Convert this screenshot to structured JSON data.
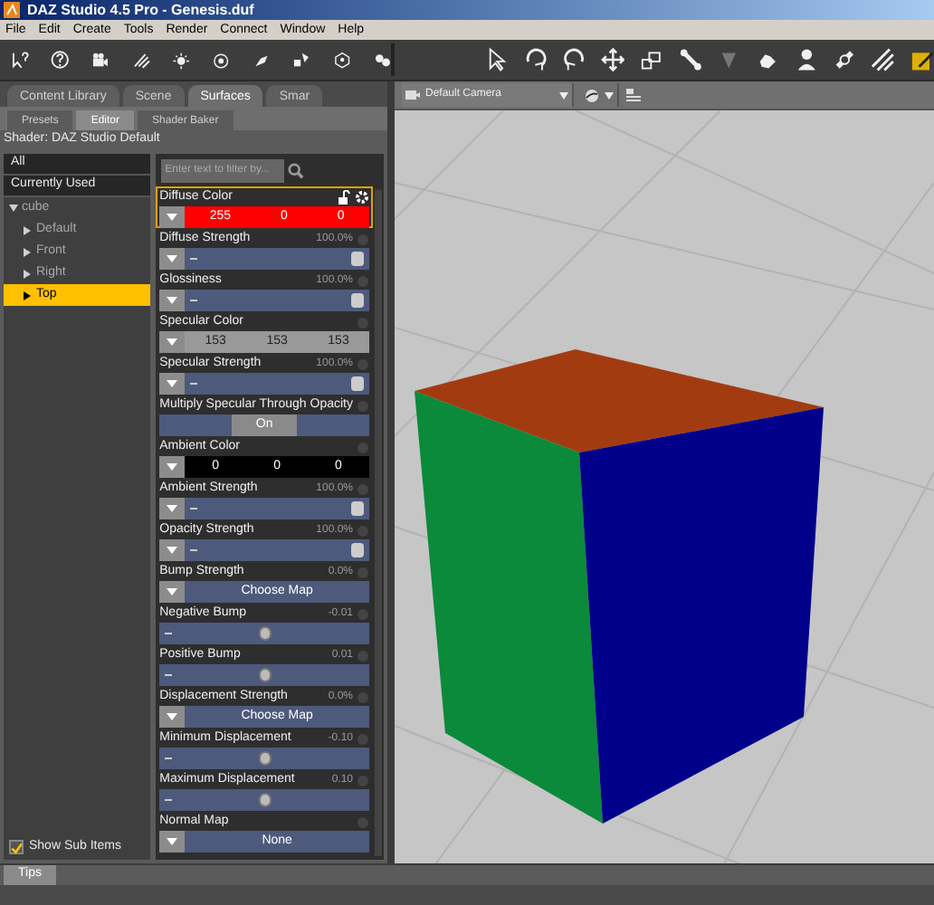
{
  "window": {
    "title": "DAZ Studio 4.5 Pro - Genesis.duf"
  },
  "menu": [
    "File",
    "Edit",
    "Create",
    "Tools",
    "Render",
    "Connect",
    "Window",
    "Help"
  ],
  "pane_tabs": [
    {
      "label": "Content Library",
      "selected": false
    },
    {
      "label": "Scene",
      "selected": false
    },
    {
      "label": "Surfaces",
      "selected": true
    },
    {
      "label": "Smar",
      "selected": false
    }
  ],
  "sub_tabs": [
    {
      "label": "Presets",
      "selected": false
    },
    {
      "label": "Editor",
      "selected": true
    },
    {
      "label": "Shader Baker",
      "selected": false
    }
  ],
  "shader_label": "Shader: DAZ Studio Default",
  "surface_groups": [
    {
      "label": "All",
      "selected": false
    },
    {
      "label": "Currently Used",
      "selected": false
    }
  ],
  "tree": [
    {
      "label": "cube",
      "expanded": true,
      "selected": false,
      "children": [
        {
          "label": "Default",
          "selected": false
        },
        {
          "label": "Front",
          "selected": false
        },
        {
          "label": "Right",
          "selected": false
        },
        {
          "label": "Top",
          "selected": true
        }
      ]
    }
  ],
  "show_sub_items": {
    "label": "Show Sub Items",
    "checked": true
  },
  "filter": {
    "placeholder": "Enter text to filter by..."
  },
  "properties": [
    {
      "kind": "color",
      "label": "Diffuse Color",
      "selected": true,
      "color": "#ff0000",
      "values": [
        "255",
        "0",
        "0"
      ]
    },
    {
      "kind": "slider",
      "label": "Diffuse Strength",
      "selected": false,
      "reading": "100.0%",
      "level": 0.97
    },
    {
      "kind": "slider",
      "label": "Glossiness",
      "selected": false,
      "reading": "100.0%",
      "level": 0.97
    },
    {
      "kind": "color",
      "label": "Specular Color",
      "selected": false,
      "color": "#999999",
      "values": [
        "153",
        "153",
        "153"
      ]
    },
    {
      "kind": "slider",
      "label": "Specular Strength",
      "selected": false,
      "reading": "100.0%",
      "level": 0.97
    },
    {
      "kind": "toggle",
      "label": "Multiply Specular Through Opacity",
      "selected": false,
      "value": "On"
    },
    {
      "kind": "color",
      "label": "Ambient Color",
      "selected": false,
      "color": "#000000",
      "values": [
        "0",
        "0",
        "0"
      ]
    },
    {
      "kind": "slider",
      "label": "Ambient Strength",
      "selected": false,
      "reading": "100.0%",
      "level": 0.97
    },
    {
      "kind": "slider",
      "label": "Opacity Strength",
      "selected": false,
      "reading": "100.0%",
      "level": 0.97
    },
    {
      "kind": "map",
      "label": "Bump Strength",
      "selected": false,
      "reading": "0.0%",
      "value": "Choose Map"
    },
    {
      "kind": "knob",
      "label": "Negative Bump",
      "selected": false,
      "reading": "-0.01",
      "level": 0.5
    },
    {
      "kind": "knob",
      "label": "Positive Bump",
      "selected": false,
      "reading": "0.01",
      "level": 0.5
    },
    {
      "kind": "map",
      "label": "Displacement Strength",
      "selected": false,
      "reading": "0.0%",
      "value": "Choose Map"
    },
    {
      "kind": "knob",
      "label": "Minimum Displacement",
      "selected": false,
      "reading": "-0.10",
      "level": 0.5
    },
    {
      "kind": "knob",
      "label": "Maximum Displacement",
      "selected": false,
      "reading": "0.10",
      "level": 0.5
    },
    {
      "kind": "map",
      "label": "Normal Map",
      "selected": false,
      "value": "None"
    }
  ],
  "viewport": {
    "camera": "Default Camera"
  },
  "bottom_tabs": [
    {
      "label": "Tips",
      "selected": true
    }
  ]
}
